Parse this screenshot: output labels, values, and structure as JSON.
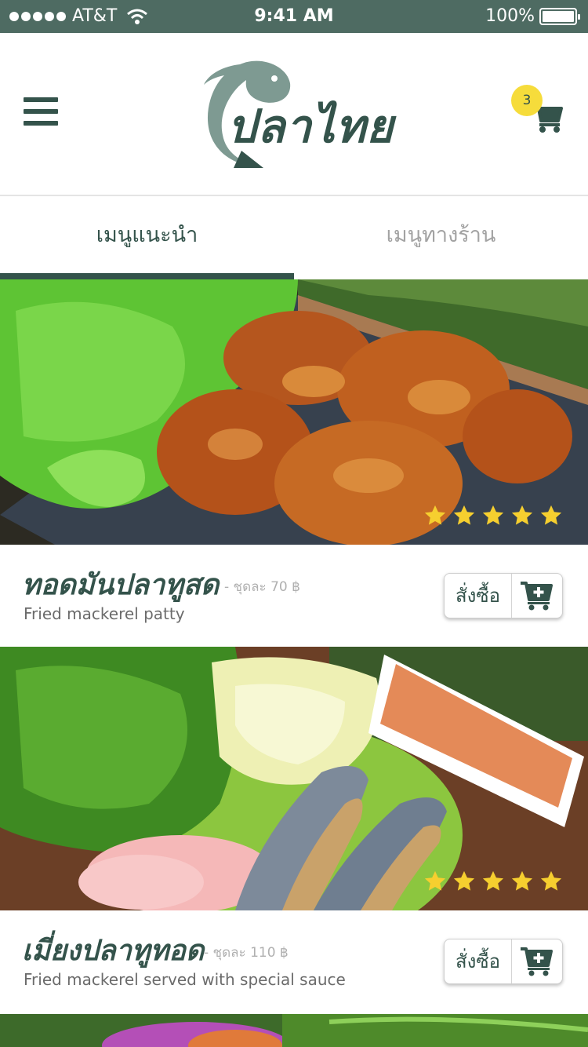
{
  "status_bar": {
    "carrier": "AT&T",
    "time": "9:41 AM",
    "battery": "100%"
  },
  "header": {
    "logo_text": "ปลาไทย",
    "cart_count": "3"
  },
  "tabs": [
    {
      "label": "เมนูแนะนำ",
      "active": true
    },
    {
      "label": "เมนูทางร้าน",
      "active": false
    }
  ],
  "menu_items": [
    {
      "name_th": "ทอดมันปลาทูสด",
      "price": "- ชุดละ 70 ฿",
      "name_en": "Fried mackerel patty",
      "rating": 5,
      "order_label": "สั่งซื้อ"
    },
    {
      "name_th": "เมี่ยงปลาทูทอด",
      "price": "- ชุดละ 110 ฿",
      "name_en": "Fried mackerel served with special sauce",
      "rating": 5,
      "order_label": "สั่งซื้อ"
    }
  ],
  "icons": {
    "menu": "hamburger-menu-icon",
    "cart": "shopping-cart-icon",
    "add_to_cart": "add-to-cart-icon",
    "star": "star-icon"
  },
  "colors": {
    "brand": "#34534b",
    "status_bar": "#4e6b62",
    "badge": "#f6dc3b",
    "star": "#f6cf2f"
  }
}
